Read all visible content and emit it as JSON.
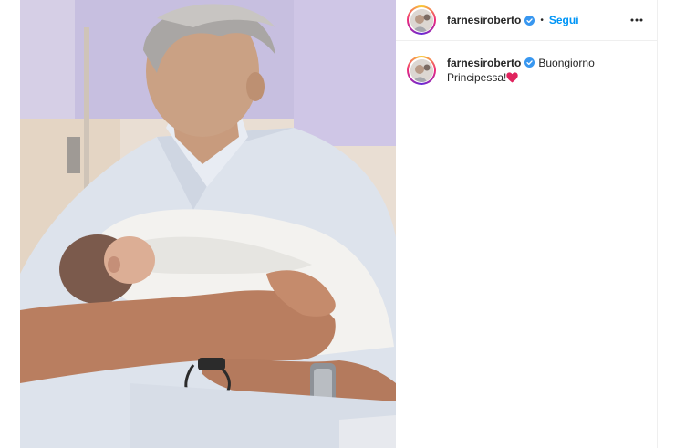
{
  "post": {
    "author": {
      "username": "farnesiroberto",
      "verified": true
    },
    "header": {
      "separator": "•",
      "follow_label": "Segui",
      "more_icon": "more-horizontal-icon"
    },
    "caption": {
      "username": "farnesiroberto",
      "text": "Buongiorno Principessa!",
      "emoji": "red-heart"
    },
    "photo": {
      "description_icon": "photo"
    }
  },
  "colors": {
    "accent": "#0095f6",
    "verified_badge": "#3897f0",
    "text": "#262626",
    "divider": "#efefef",
    "heart": "#e0245e"
  }
}
